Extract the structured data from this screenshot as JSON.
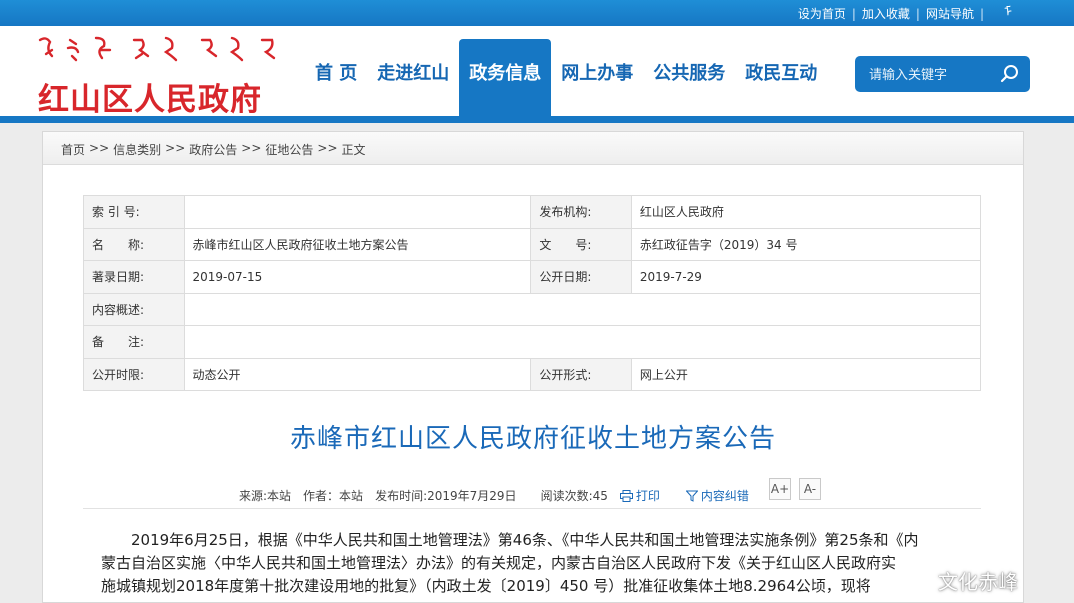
{
  "topbar": {
    "links": [
      "设为首页",
      "加入收藏",
      "网站导航"
    ]
  },
  "header": {
    "site_name": "红山区人民政府",
    "nav": [
      "首 页",
      "走进红山",
      "政务信息",
      "网上办事",
      "公共服务",
      "政民互动"
    ],
    "active_nav": "政务信息",
    "search_placeholder": "请输入关键字"
  },
  "breadcrumb": [
    "首页",
    "信息类别",
    "政府公告",
    "征地公告",
    "正文"
  ],
  "info_table": {
    "rows": [
      {
        "l1": "索 引 号:",
        "v1": "",
        "l2": "发布机构:",
        "v2": "红山区人民政府"
      },
      {
        "l1": "名　　称:",
        "v1": "赤峰市红山区人民政府征收土地方案公告",
        "l2": "文　　号:",
        "v2": "赤红政征告字（2019）34 号"
      },
      {
        "l1": "著录日期:",
        "v1": "2019-07-15",
        "l2": "公开日期:",
        "v2": "2019-7-29"
      },
      {
        "l1": "内容概述:",
        "v1": ""
      },
      {
        "l1": "备　　注:",
        "v1": ""
      },
      {
        "l1": "公开时限:",
        "v1": "动态公开",
        "l2": "公开形式:",
        "v2": "网上公开"
      }
    ]
  },
  "article": {
    "title": "赤峰市红山区人民政府征收土地方案公告",
    "source": "来源:本站",
    "author": "作者：本站",
    "publish_time": "发布时间:2019年7月29日",
    "read_count": "阅读次数:45",
    "print_label": "打印",
    "correct_label": "内容纠错",
    "font_up": "A+",
    "font_down": "A-",
    "body_lines": [
      "2019年6月25日，根据《中华人民共和国土地管理法》第46条、《中华人民共和国土地管理法实施条例》第25条和《内",
      "蒙古自治区实施〈中华人民共和国土地管理法〉办法》的有关规定，内蒙古自治区人民政府下发《关于红山区人民政府实",
      "施城镇规划2018年度第十批次建设用地的批复》（内政土发〔2019〕450 号）批准征收集体土地8.2964公顷，现将"
    ]
  },
  "watermark": "文化赤峰",
  "colors": {
    "brand_blue": "#1677c4",
    "title_red": "#d8262b",
    "link_blue": "#1a69b8"
  }
}
